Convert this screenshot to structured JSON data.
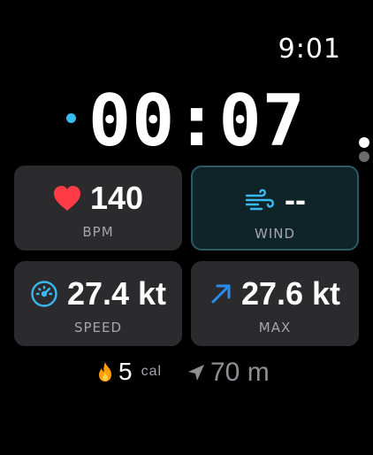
{
  "status": {
    "time": "9:01"
  },
  "workout": {
    "elapsed": "00:07"
  },
  "metrics": [
    {
      "id": "heart-rate",
      "value": "140",
      "label": "BPM",
      "icon": "heart-icon",
      "color": "#ff3b46"
    },
    {
      "id": "wind",
      "value": "--",
      "label": "WIND",
      "icon": "wind-icon",
      "color": "#3ab8ef"
    },
    {
      "id": "speed",
      "value": "27.4 kt",
      "label": "SPEED",
      "icon": "speedometer-icon",
      "color": "#3ab8ef"
    },
    {
      "id": "max-speed",
      "value": "27.6 kt",
      "label": "MAX",
      "icon": "arrow-up-right-icon",
      "color": "#2b8cf0"
    }
  ],
  "footer": {
    "calories": {
      "value": "5",
      "unit": "cal",
      "icon": "flame-icon",
      "color": "#ff9f0a"
    },
    "distance": {
      "value": "70 m",
      "icon": "location-arrow-icon",
      "color": "#8e8e93"
    }
  },
  "pager": {
    "total": 2,
    "active": 1
  }
}
